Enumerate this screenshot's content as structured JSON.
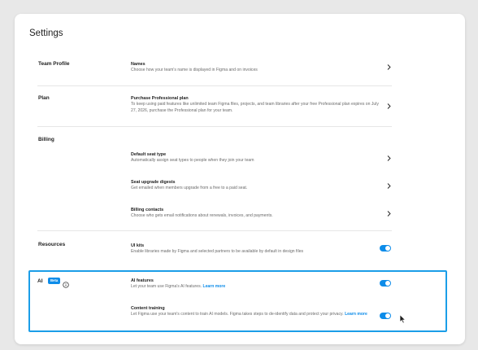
{
  "page": {
    "title": "Settings"
  },
  "sections": {
    "team_profile": {
      "label": "Team Profile",
      "rows": [
        {
          "title": "Names",
          "desc": "Choose how your team's name is displayed in Figma and on invoices"
        }
      ]
    },
    "plan": {
      "label": "Plan",
      "rows": [
        {
          "title": "Purchase Professional plan",
          "desc": "To keep using paid features like unlimited team Figma files, projects, and team libraries after your free Professional plan expires on July 27, 2026, purchase the Professional plan for your team."
        }
      ]
    },
    "billing": {
      "label": "Billing",
      "rows": [
        {
          "title": "Default seat type",
          "desc": "Automatically assign seat types to people when they join your team"
        },
        {
          "title": "Seat upgrade digests",
          "desc": "Get emailed when members upgrade from a free to a paid seat."
        },
        {
          "title": "Billing contacts",
          "desc": "Choose who gets email notifications about renewals, invoices, and payments."
        }
      ]
    },
    "resources": {
      "label": "Resources",
      "rows": [
        {
          "title": "UI kits",
          "desc": "Enable libraries made by Figma and selected partners to be available by default in design files",
          "enabled": true
        }
      ]
    },
    "ai": {
      "label": "AI",
      "badge": "Beta",
      "rows": [
        {
          "title": "AI features",
          "desc": "Let your team use Figma's AI features.",
          "link": "Learn more",
          "enabled": true
        },
        {
          "title": "Content training",
          "desc": "Let Figma use your team's content to train AI models. Figma takes steps to de-identify data and protect your privacy.",
          "link": "Learn more",
          "enabled": true
        }
      ]
    }
  },
  "icons": {
    "chevron": "chevron-right-icon",
    "info": "info-icon",
    "cursor": "mouse-pointer-icon"
  },
  "colors": {
    "accent": "#0d8ce9",
    "highlight": "#1b9ee8"
  }
}
